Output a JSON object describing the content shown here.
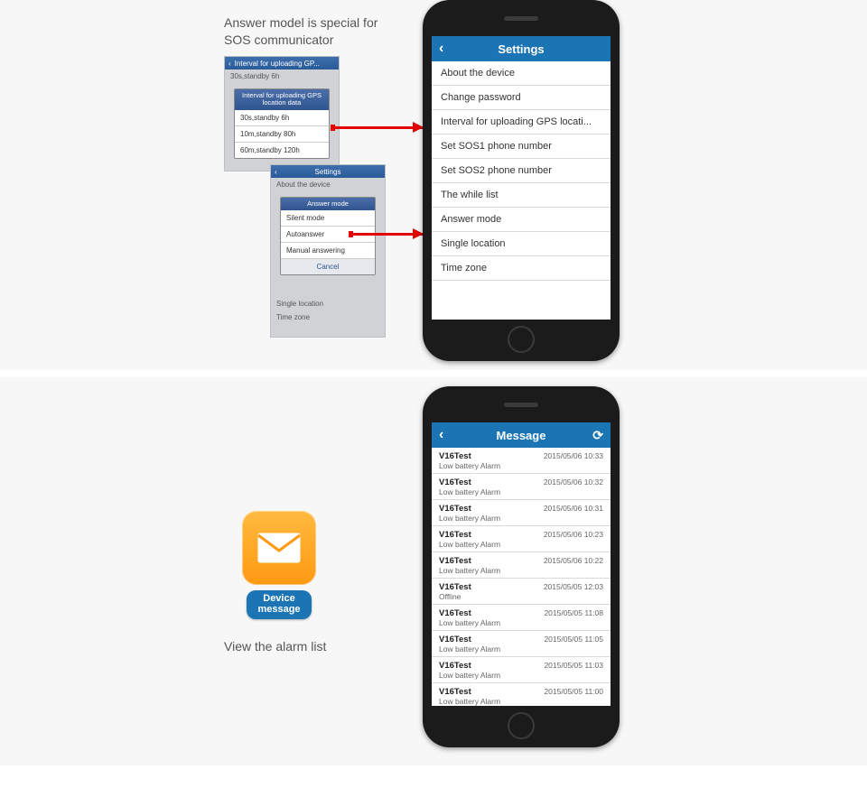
{
  "top_caption_line1": "Answer model is special for",
  "top_caption_line2": "SOS communicator",
  "phone_settings": {
    "header_title": "Settings",
    "rows": [
      "About the device",
      "Change password",
      "Interval for uploading GPS locati...",
      "Set SOS1 phone number",
      "Set SOS2 phone number",
      "The while list",
      "Answer mode",
      "Single location",
      "Time zone"
    ]
  },
  "mini1": {
    "header": "Interval for uploading GP...",
    "bg_row": "30s,standby 6h",
    "dialog_title1": "Interval for uploading GPS",
    "dialog_title2": "location data",
    "opts": [
      "30s,standby 6h",
      "10m,standby 80h",
      "60m,standby 120h"
    ]
  },
  "mini2": {
    "header": "Settings",
    "pre_row": "About the device",
    "dialog_title": "Answer mode",
    "opts": [
      "Silent mode",
      "Autoanswer",
      "Manual answering"
    ],
    "cancel": "Cancel",
    "post_rows": [
      "Single location",
      "Time zone"
    ]
  },
  "device_msg_label1": "Device",
  "device_msg_label2": "message",
  "view_alarm": "View the alarm list",
  "phone_messages": {
    "header_title": "Message",
    "rows": [
      {
        "t1": "V16Test",
        "t2": "Low battery Alarm",
        "ts": "2015/05/06 10:33"
      },
      {
        "t1": "V16Test",
        "t2": "Low battery Alarm",
        "ts": "2015/05/06 10:32"
      },
      {
        "t1": "V16Test",
        "t2": "Low battery Alarm",
        "ts": "2015/05/06 10:31"
      },
      {
        "t1": "V16Test",
        "t2": "Low battery Alarm",
        "ts": "2015/05/06 10:23"
      },
      {
        "t1": "V16Test",
        "t2": "Low battery Alarm",
        "ts": "2015/05/06 10:22"
      },
      {
        "t1": "V16Test",
        "t2": "Offline",
        "ts": "2015/05/05 12:03"
      },
      {
        "t1": "V16Test",
        "t2": "Low battery Alarm",
        "ts": "2015/05/05 11:08"
      },
      {
        "t1": "V16Test",
        "t2": "Low battery Alarm",
        "ts": "2015/05/05 11:05"
      },
      {
        "t1": "V16Test",
        "t2": "Low battery Alarm",
        "ts": "2015/05/05 11:03"
      },
      {
        "t1": "V16Test",
        "t2": "Low battery Alarm",
        "ts": "2015/05/05 11:00"
      }
    ]
  }
}
